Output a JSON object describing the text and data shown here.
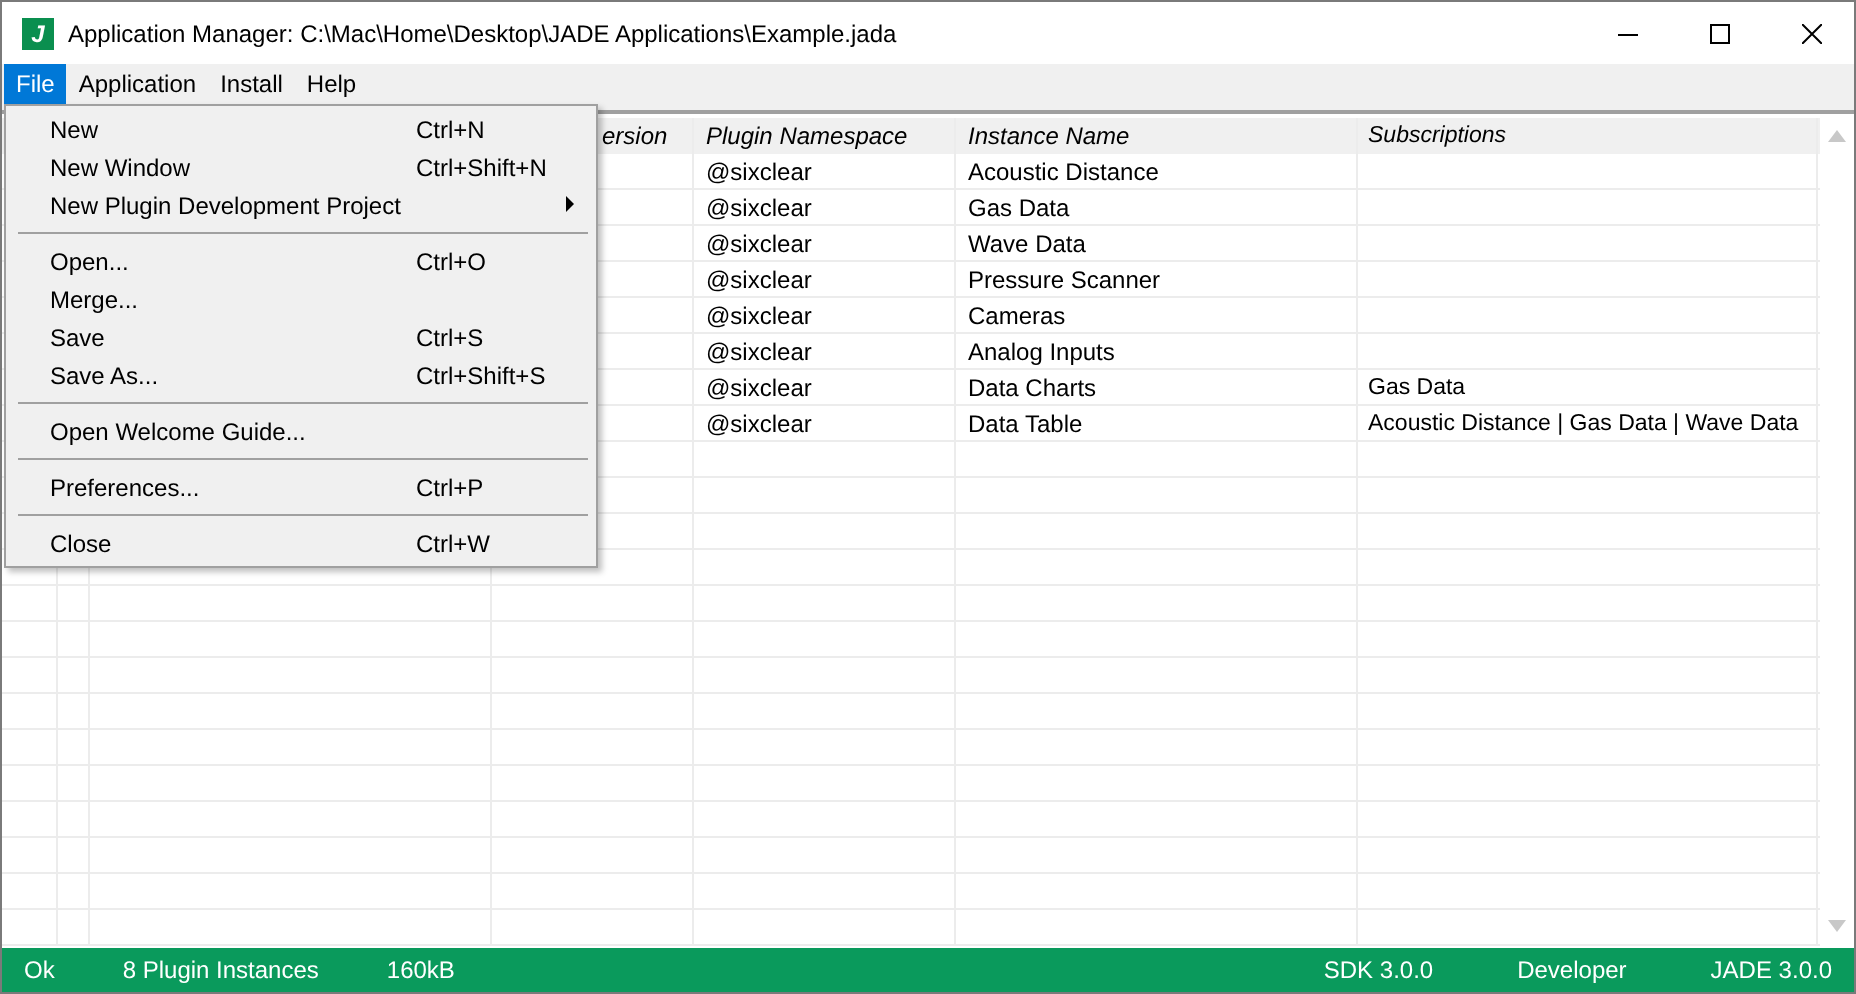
{
  "window": {
    "icon_letter": "J",
    "title": "Application Manager: C:\\Mac\\Home\\Desktop\\JADE Applications\\Example.jada"
  },
  "menubar": [
    {
      "label": "File",
      "selected": true
    },
    {
      "label": "Application",
      "selected": false
    },
    {
      "label": "Install",
      "selected": false
    },
    {
      "label": "Help",
      "selected": false
    }
  ],
  "file_menu": [
    {
      "kind": "item",
      "label": "New",
      "shortcut": "Ctrl+N"
    },
    {
      "kind": "item",
      "label": "New Window",
      "shortcut": "Ctrl+Shift+N"
    },
    {
      "kind": "submenu",
      "label": "New Plugin Development Project"
    },
    {
      "kind": "separator"
    },
    {
      "kind": "item",
      "label": "Open...",
      "shortcut": "Ctrl+O"
    },
    {
      "kind": "item",
      "label": "Merge..."
    },
    {
      "kind": "item",
      "label": "Save",
      "shortcut": "Ctrl+S"
    },
    {
      "kind": "item",
      "label": "Save As...",
      "shortcut": "Ctrl+Shift+S"
    },
    {
      "kind": "separator"
    },
    {
      "kind": "item",
      "label": "Open Welcome Guide..."
    },
    {
      "kind": "separator"
    },
    {
      "kind": "item",
      "label": "Preferences...",
      "shortcut": "Ctrl+P"
    },
    {
      "kind": "separator"
    },
    {
      "kind": "item",
      "label": "Close",
      "shortcut": "Ctrl+W"
    }
  ],
  "table": {
    "columns": [
      "ersion",
      "Plugin Namespace",
      "Instance Name",
      "Subscriptions"
    ],
    "rows": [
      [
        "",
        "@sixclear",
        "Acoustic Distance",
        ""
      ],
      [
        "",
        "@sixclear",
        "Gas Data",
        ""
      ],
      [
        "",
        "@sixclear",
        "Wave Data",
        ""
      ],
      [
        "",
        "@sixclear",
        "Pressure Scanner",
        ""
      ],
      [
        "",
        "@sixclear",
        "Cameras",
        ""
      ],
      [
        "",
        "@sixclear",
        "Analog Inputs",
        ""
      ],
      [
        "",
        "@sixclear",
        "Data Charts",
        "Gas Data"
      ],
      [
        "",
        "@sixclear",
        "Data Table",
        "Acoustic Distance | Gas Data | Wave Data"
      ]
    ]
  },
  "status_bar": {
    "left": [
      "Ok",
      "8 Plugin Instances",
      "160kB"
    ],
    "right": [
      "SDK 3.0.0",
      "Developer",
      "JADE 3.0.0"
    ]
  }
}
